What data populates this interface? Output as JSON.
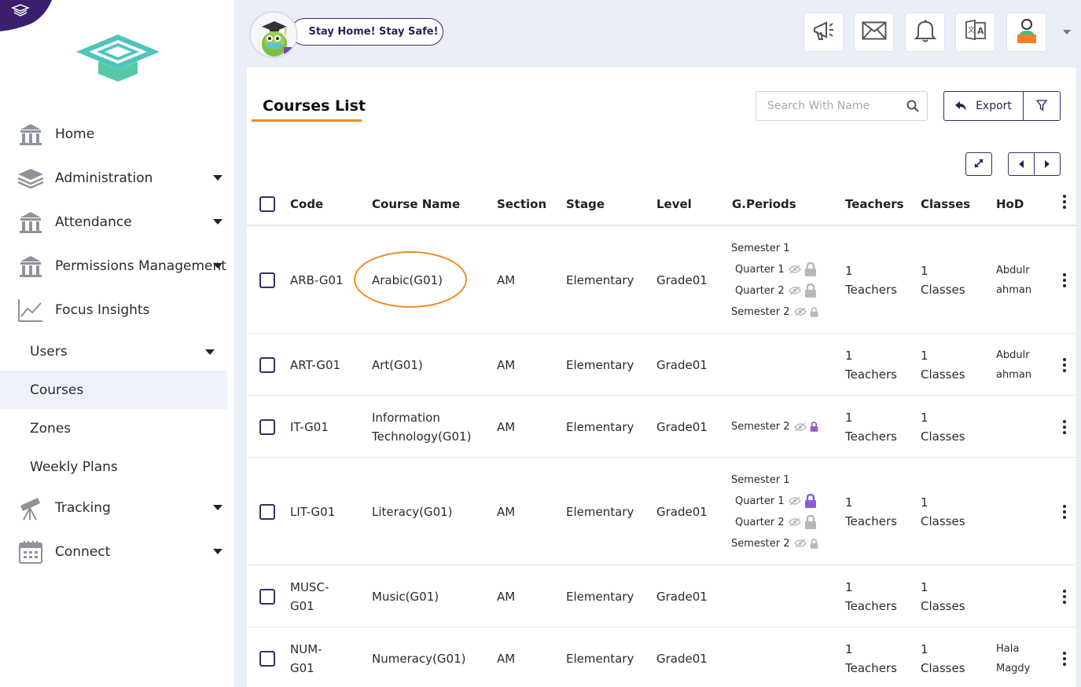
{
  "sidebar": {
    "items": [
      {
        "label": "Home",
        "icon": "building-icon",
        "has_caret": false
      },
      {
        "label": "Administration",
        "icon": "layers-icon",
        "has_caret": true
      },
      {
        "label": "Attendance",
        "icon": "building-icon",
        "has_caret": true
      },
      {
        "label": "Permissions Management",
        "icon": "building-icon",
        "has_caret": true
      },
      {
        "label": "Focus Insights",
        "icon": "chart-icon",
        "has_caret": false
      }
    ],
    "sub_items": [
      {
        "label": "Users",
        "has_caret": true
      },
      {
        "label": "Courses",
        "active": true
      },
      {
        "label": "Zones"
      },
      {
        "label": "Weekly Plans"
      }
    ],
    "bottom_items": [
      {
        "label": "Tracking",
        "icon": "telescope-icon",
        "has_caret": true
      },
      {
        "label": "Connect",
        "icon": "calendar-icon",
        "has_caret": true
      }
    ]
  },
  "header": {
    "banner": "Stay Home! Stay Safe!"
  },
  "page": {
    "title": "Courses List",
    "search_placeholder": "Search With Name",
    "export_label": "Export"
  },
  "table": {
    "headers": [
      "Code",
      "Course Name",
      "Section",
      "Stage",
      "Level",
      "G.Periods",
      "Teachers",
      "Classes",
      "HoD"
    ],
    "rows": [
      {
        "code": [
          "ARB-G01"
        ],
        "name": [
          "Arabic(G01)"
        ],
        "section": "AM",
        "stage": "Elementary",
        "level": "Grade01",
        "periods": [
          {
            "label": "Semester 1",
            "indent": false,
            "eye": false,
            "lock": "none"
          },
          {
            "label": "Quarter 1",
            "indent": true,
            "eye": true,
            "lock": "grey-big"
          },
          {
            "label": "Quarter 2",
            "indent": true,
            "eye": true,
            "lock": "grey-big"
          },
          {
            "label": "Semester 2",
            "indent": false,
            "eye": true,
            "lock": "grey-small"
          }
        ],
        "teachers": [
          "1",
          "Teachers"
        ],
        "classes": [
          "1",
          "Classes"
        ],
        "hod": [
          "Abdulr",
          "ahman"
        ]
      },
      {
        "code": [
          "ART-G01"
        ],
        "name": [
          "Art(G01)"
        ],
        "section": "AM",
        "stage": "Elementary",
        "level": "Grade01",
        "periods": [],
        "teachers": [
          "1",
          "Teachers"
        ],
        "classes": [
          "1",
          "Classes"
        ],
        "hod": [
          "Abdulr",
          "ahman"
        ]
      },
      {
        "code": [
          "IT-G01"
        ],
        "name": [
          "Information",
          "Technology(G01)"
        ],
        "section": "AM",
        "stage": "Elementary",
        "level": "Grade01",
        "periods": [
          {
            "label": "Semester 2",
            "indent": false,
            "eye": true,
            "lock": "purple-small"
          }
        ],
        "teachers": [
          "1",
          "Teachers"
        ],
        "classes": [
          "1",
          "Classes"
        ],
        "hod": []
      },
      {
        "code": [
          "LIT-G01"
        ],
        "name": [
          "Literacy(G01)"
        ],
        "section": "AM",
        "stage": "Elementary",
        "level": "Grade01",
        "periods": [
          {
            "label": "Semester 1",
            "indent": false,
            "eye": false,
            "lock": "none"
          },
          {
            "label": "Quarter 1",
            "indent": true,
            "eye": true,
            "lock": "purple-big"
          },
          {
            "label": "Quarter 2",
            "indent": true,
            "eye": true,
            "lock": "grey-big"
          },
          {
            "label": "Semester 2",
            "indent": false,
            "eye": true,
            "lock": "grey-small"
          }
        ],
        "teachers": [
          "1",
          "Teachers"
        ],
        "classes": [
          "1",
          "Classes"
        ],
        "hod": []
      },
      {
        "code": [
          "MUSC-",
          "G01"
        ],
        "name": [
          "Music(G01)"
        ],
        "section": "AM",
        "stage": "Elementary",
        "level": "Grade01",
        "periods": [],
        "teachers": [
          "1",
          "Teachers"
        ],
        "classes": [
          "1",
          "Classes"
        ],
        "hod": []
      },
      {
        "code": [
          "NUM-",
          "G01"
        ],
        "name": [
          "Numeracy(G01)"
        ],
        "section": "AM",
        "stage": "Elementary",
        "level": "Grade01",
        "periods": [],
        "teachers": [
          "1",
          "Teachers"
        ],
        "classes": [
          "1",
          "Classes"
        ],
        "hod": [
          "Hala",
          "Magdy"
        ]
      }
    ]
  },
  "colors": {
    "accent": "#3a2a6b",
    "highlight": "#f08a24",
    "lock_purple": "#8f5bd6",
    "lock_grey": "#b5b8bf"
  }
}
